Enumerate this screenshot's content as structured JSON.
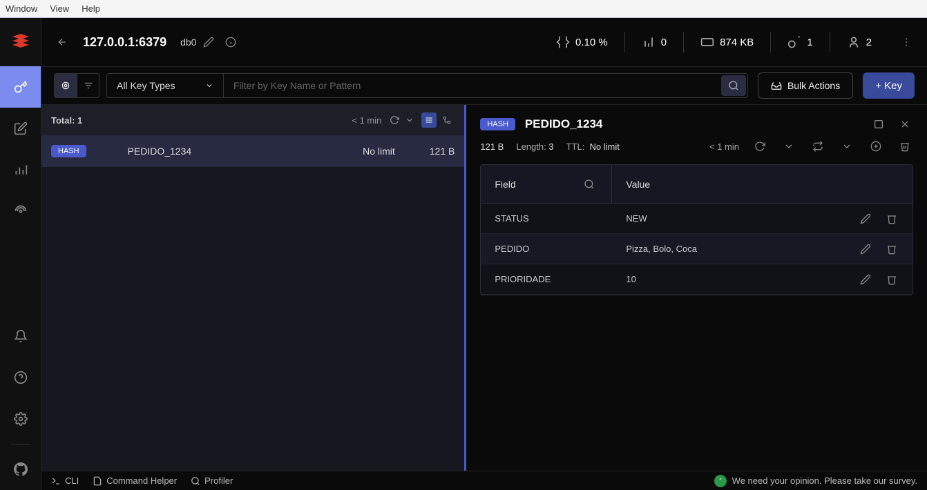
{
  "menubar": {
    "items": [
      "Window",
      "View",
      "Help"
    ]
  },
  "connection": {
    "host": "127.0.0.1:6379",
    "db": "db0"
  },
  "stats": {
    "cpu": "0.10 %",
    "commands": "0",
    "memory": "874 KB",
    "keys": "1",
    "clients": "2"
  },
  "toolbar": {
    "key_types": "All Key Types",
    "search_placeholder": "Filter by Key Name or Pattern",
    "bulk": "Bulk Actions",
    "add_key": "+ Key"
  },
  "list": {
    "total_label": "Total: ",
    "total": "1",
    "updated": "< 1 min",
    "rows": [
      {
        "type": "HASH",
        "name": "PEDIDO_1234",
        "ttl": "No limit",
        "size": "121 B"
      }
    ]
  },
  "detail": {
    "badge": "HASH",
    "title": "PEDIDO_1234",
    "size": "121 B",
    "length_label": "Length: ",
    "length": "3",
    "ttl_label": "TTL:",
    "ttl": "No limit",
    "updated": "< 1 min",
    "columns": {
      "field": "Field",
      "value": "Value"
    },
    "entries": [
      {
        "field": "STATUS",
        "value": "NEW"
      },
      {
        "field": "PEDIDO",
        "value": "Pizza, Bolo, Coca"
      },
      {
        "field": "PRIORIDADE",
        "value": "10"
      }
    ]
  },
  "footer": {
    "cli": "CLI",
    "helper": "Command Helper",
    "profiler": "Profiler",
    "survey": "We need your opinion. Please take our survey."
  }
}
